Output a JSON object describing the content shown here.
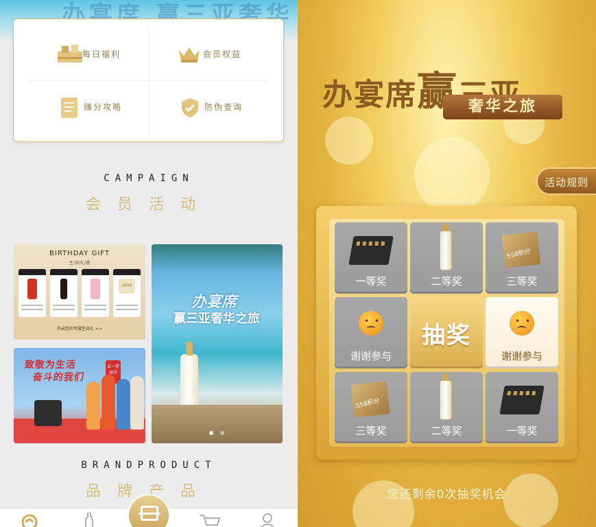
{
  "left": {
    "banner_text": "办宴席 赢三亚奢华之旅",
    "menu": [
      {
        "label": "每日福利",
        "icon": "gift-store-icon"
      },
      {
        "label": "会员权益",
        "icon": "crown-icon"
      },
      {
        "label": "赚分攻略",
        "icon": "checklist-icon"
      },
      {
        "label": "防伪查询",
        "icon": "shield-check-icon"
      }
    ],
    "campaign_en": "CAMPAIGN",
    "campaign_zh": "会员活动",
    "birthday": {
      "title": "BIRTHDAY GIFT",
      "subtitle": "生/日/礼/遇",
      "tags": [
        "黄金会员",
        "铂金会员",
        "钻石会员",
        "至尊会员"
      ],
      "link": "开启您的专属生日礼 >>",
      "card_value": "3000"
    },
    "worker": {
      "line1": "致敬为生活",
      "line2": "奋斗的我们",
      "badge": "五一劳动节"
    },
    "sanya": {
      "line1": "办宴席",
      "line2": "赢三亚奢华之旅"
    },
    "brand_en": "BRANDPRODUCT",
    "brand_zh": "品牌产品",
    "nav": [
      "home-icon",
      "bottle-icon",
      "scan-icon",
      "cart-icon",
      "profile-icon"
    ]
  },
  "right": {
    "title_part1": "办宴席",
    "title_part2": "赢",
    "title_part3": "三亚",
    "title_sub": "奢华之旅",
    "rules_label": "活动规则",
    "cells": [
      {
        "label": "一等奖",
        "prize": "gift-box"
      },
      {
        "label": "二等奖",
        "prize": "bottle"
      },
      {
        "label": "三等奖",
        "prize": "points",
        "points_text": "558积分"
      },
      {
        "label": "谢谢参与",
        "prize": "sad-face"
      },
      {
        "label": "抽奖",
        "prize": "draw"
      },
      {
        "label": "谢谢参与",
        "prize": "sad-face"
      },
      {
        "label": "三等奖",
        "prize": "points",
        "points_text": "558积分"
      },
      {
        "label": "二等奖",
        "prize": "bottle"
      },
      {
        "label": "一等奖",
        "prize": "gift-box"
      }
    ],
    "chance_text": "您还剩余0次抽奖机会",
    "active_cell": 5
  }
}
